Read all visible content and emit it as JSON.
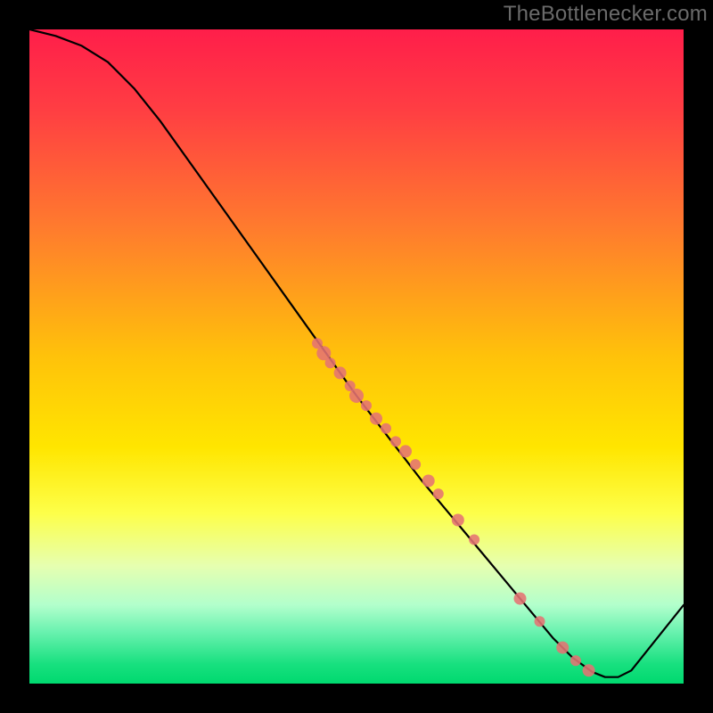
{
  "watermark": "TheBottlenecker.com",
  "colors": {
    "background": "#000000",
    "gradient_top": "#ff1e4a",
    "gradient_mid": "#ffe600",
    "gradient_bottom": "#00d96f",
    "curve": "#000000",
    "marker": "#e57373"
  },
  "chart_data": {
    "type": "line",
    "title": "",
    "xlabel": "",
    "ylabel": "",
    "xlim": [
      0,
      100
    ],
    "ylim": [
      0,
      100
    ],
    "series": [
      {
        "name": "bottleneck-curve",
        "x": [
          0,
          4,
          8,
          12,
          16,
          20,
          25,
          30,
          35,
          40,
          45,
          50,
          55,
          60,
          65,
          70,
          75,
          80,
          83,
          86,
          88,
          90,
          92,
          100
        ],
        "y": [
          100,
          99,
          97.5,
          95,
          91,
          86,
          79,
          72,
          65,
          58,
          51,
          44,
          37.5,
          31,
          25,
          19,
          13,
          7,
          4,
          1.8,
          1,
          1,
          2,
          12
        ]
      }
    ],
    "markers": {
      "name": "highlighted-points",
      "x": [
        44,
        45,
        46,
        47.5,
        49,
        50,
        51.5,
        53,
        54.5,
        56,
        57.5,
        59,
        61,
        62.5,
        65.5,
        68,
        75,
        78,
        81.5,
        83.5,
        85.5
      ],
      "y": [
        52,
        50.5,
        49,
        47.5,
        45.5,
        44,
        42.5,
        40.5,
        39,
        37,
        35.5,
        33.5,
        31,
        29,
        25,
        22,
        13,
        9.5,
        5.5,
        3.5,
        2
      ],
      "r": [
        6,
        8,
        6,
        7,
        6,
        8,
        6,
        7,
        6,
        6,
        7,
        6,
        7,
        6,
        7,
        6,
        7,
        6,
        7,
        6,
        7
      ]
    }
  }
}
